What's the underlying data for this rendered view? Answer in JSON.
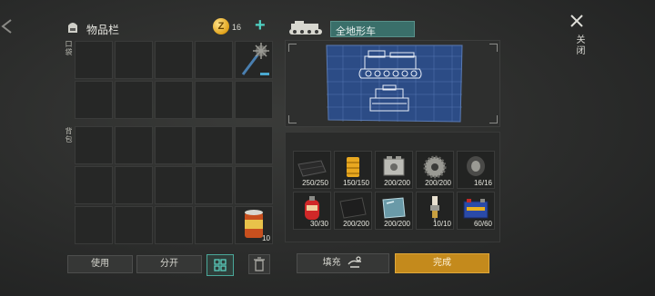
{
  "inventory": {
    "title": "物品栏"
  },
  "currency": {
    "symbol": "Z",
    "amount": "16"
  },
  "sections": {
    "pocket": "口袋",
    "backpack": "背包"
  },
  "pocket_items": [
    {
      "slot": 4,
      "name": "spiked-mace-icon",
      "qty": ""
    }
  ],
  "backpack_items": [
    {
      "slot": 14,
      "name": "food-can-icon",
      "qty": "10"
    }
  ],
  "buttons": {
    "use": "使用",
    "split": "分开",
    "fill": "填充",
    "done": "完成"
  },
  "vehicle": {
    "name": "全地形车"
  },
  "materials": [
    {
      "name": "cloth-icon",
      "qty": "250/250"
    },
    {
      "name": "oil-filter-icon",
      "qty": "150/150"
    },
    {
      "name": "engine-block-icon",
      "qty": "200/200"
    },
    {
      "name": "gear-icon",
      "qty": "200/200"
    },
    {
      "name": "tire-icon",
      "qty": "16/16"
    },
    {
      "name": "gas-canister-icon",
      "qty": "30/30"
    },
    {
      "name": "rubber-plate-icon",
      "qty": "200/200"
    },
    {
      "name": "glass-pane-icon",
      "qty": "200/200"
    },
    {
      "name": "spark-plug-icon",
      "qty": "10/10"
    },
    {
      "name": "battery-icon",
      "qty": "60/60"
    }
  ],
  "close": {
    "label": "关闭"
  },
  "colors": {
    "accent_teal": "#4fd0c2",
    "done_gold": "#c48a1c",
    "vehicle_bar": "#3a6f6a"
  }
}
